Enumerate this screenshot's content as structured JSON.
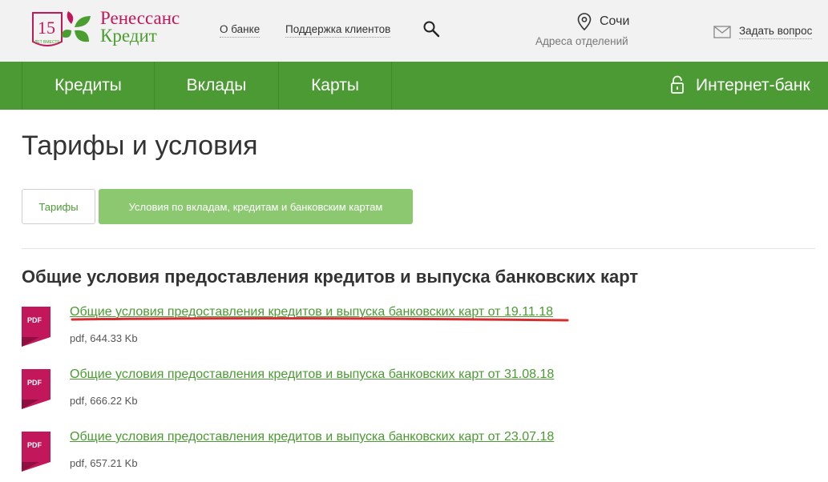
{
  "logo": {
    "badge_number": "15",
    "badge_caption": "ЛЕТ ВМЕСТЕ",
    "line1": "Ренессанс",
    "line2": "Кредит"
  },
  "header": {
    "about_link": "О банке",
    "support_link": "Поддержка клиентов",
    "city": "Сочи",
    "branches_link": "Адреса отделений",
    "ask_link": "Задать вопрос"
  },
  "nav": {
    "items": [
      {
        "label": "Кредиты"
      },
      {
        "label": "Вклады"
      },
      {
        "label": "Карты"
      }
    ],
    "internet_bank": "Интернет-банк"
  },
  "page": {
    "title": "Тарифы и условия",
    "tabs": [
      {
        "label": "Тарифы",
        "active": false
      },
      {
        "label": "Условия по вкладам, кредитам и банковским картам",
        "active": true
      }
    ],
    "section_title": "Общие условия предоставления кредитов и выпуска банковских карт",
    "documents": [
      {
        "icon_label": "PDF",
        "title": "Общие условия предоставления кредитов и выпуска банковских карт от 19.11.18",
        "meta": "pdf, 644.33 Kb",
        "highlighted": true
      },
      {
        "icon_label": "PDF",
        "title": "Общие условия предоставления кредитов и выпуска банковских карт от 31.08.18",
        "meta": "pdf, 666.22 Kb",
        "highlighted": false
      },
      {
        "icon_label": "PDF",
        "title": "Общие условия предоставления кредитов и выпуска банковских карт от 23.07.18",
        "meta": "pdf, 657.21 Kb",
        "highlighted": false
      }
    ]
  },
  "colors": {
    "brand_green": "#4b9a33",
    "active_tab_green": "#8cc870",
    "brand_magenta": "#c2185b",
    "annotation_red": "#d32f2f"
  }
}
